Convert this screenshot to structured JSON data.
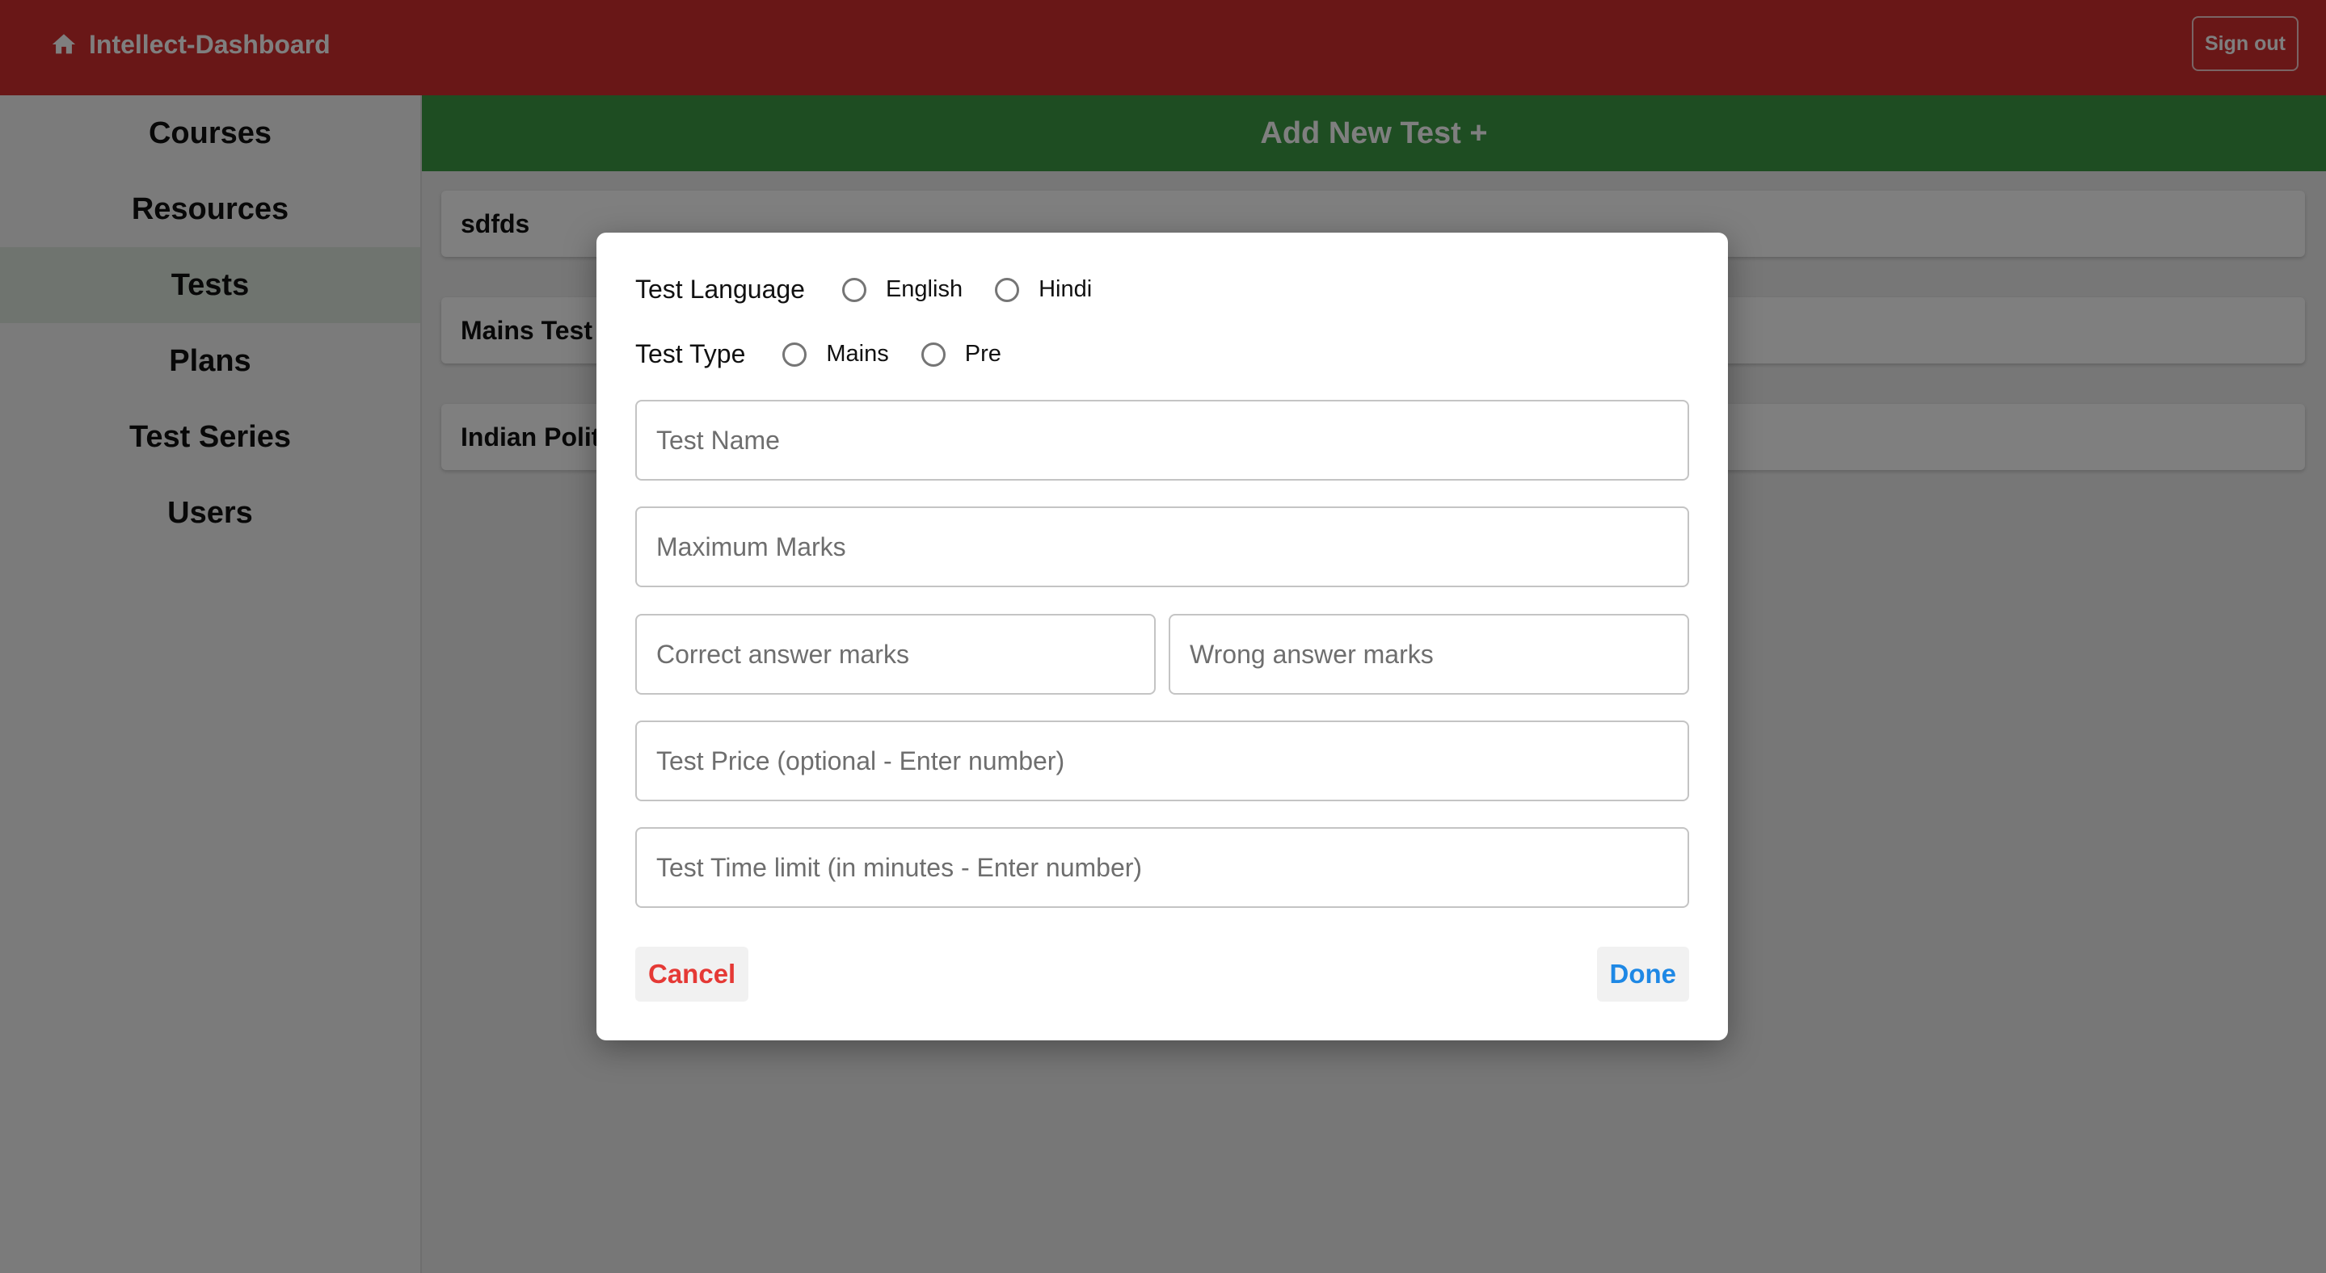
{
  "app": {
    "title": "Intellect-Dashboard",
    "sign_out_label": "Sign out",
    "brand_color": "#d32f2f"
  },
  "sidebar": {
    "items": [
      {
        "label": "Courses",
        "active": false
      },
      {
        "label": "Resources",
        "active": false
      },
      {
        "label": "Tests",
        "active": true
      },
      {
        "label": "Plans",
        "active": false
      },
      {
        "label": "Test Series",
        "active": false
      },
      {
        "label": "Users",
        "active": false
      }
    ]
  },
  "main": {
    "add_button_label": "Add New Test +",
    "add_button_color": "#3c9a45",
    "tests": [
      {
        "name": "sdfds"
      },
      {
        "name": "Mains Test"
      },
      {
        "name": "Indian Polit"
      }
    ]
  },
  "dialog": {
    "language": {
      "label": "Test Language",
      "options": [
        "English",
        "Hindi"
      ]
    },
    "type": {
      "label": "Test Type",
      "options": [
        "Mains",
        "Pre"
      ]
    },
    "fields": {
      "test_name": {
        "placeholder": "Test Name",
        "value": ""
      },
      "max_marks": {
        "placeholder": "Maximum Marks",
        "value": ""
      },
      "correct_marks": {
        "placeholder": "Correct answer marks",
        "value": ""
      },
      "wrong_marks": {
        "placeholder": "Wrong answer marks",
        "value": ""
      },
      "price": {
        "placeholder": "Test Price (optional - Enter number)",
        "value": ""
      },
      "time_limit": {
        "placeholder": "Test Time limit (in minutes - Enter number)",
        "value": ""
      }
    },
    "cancel_label": "Cancel",
    "cancel_color": "#e53935",
    "done_label": "Done",
    "done_color": "#1e88e5"
  }
}
